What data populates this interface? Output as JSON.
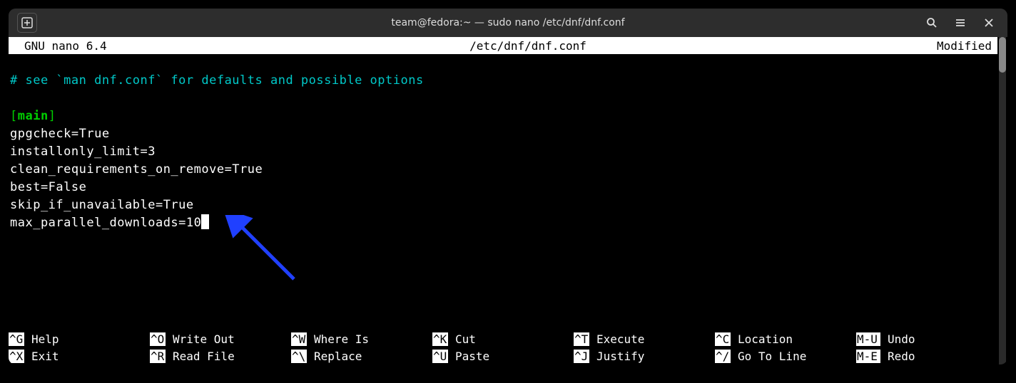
{
  "titlebar": {
    "title": "team@fedora:~ — sudo nano /etc/dnf/dnf.conf"
  },
  "nano": {
    "app_version": "GNU nano 6.4",
    "filename": "/etc/dnf/dnf.conf",
    "status": "Modified"
  },
  "file": {
    "comment": "# see `man dnf.conf` for defaults and possible options",
    "section": "main",
    "lines": {
      "l1": "gpgcheck=True",
      "l2": "installonly_limit=3",
      "l3": "clean_requirements_on_remove=True",
      "l4": "best=False",
      "l5": "skip_if_unavailable=True",
      "l6": "max_parallel_downloads=10"
    }
  },
  "shortcuts": {
    "row1": [
      {
        "key": "^G",
        "label": "Help"
      },
      {
        "key": "^O",
        "label": "Write Out"
      },
      {
        "key": "^W",
        "label": "Where Is"
      },
      {
        "key": "^K",
        "label": "Cut"
      },
      {
        "key": "^T",
        "label": "Execute"
      },
      {
        "key": "^C",
        "label": "Location"
      },
      {
        "key": "M-U",
        "label": "Undo"
      }
    ],
    "row2": [
      {
        "key": "^X",
        "label": "Exit"
      },
      {
        "key": "^R",
        "label": "Read File"
      },
      {
        "key": "^\\",
        "label": "Replace"
      },
      {
        "key": "^U",
        "label": "Paste"
      },
      {
        "key": "^J",
        "label": "Justify"
      },
      {
        "key": "^/",
        "label": "Go To Line"
      },
      {
        "key": "M-E",
        "label": "Redo"
      }
    ]
  }
}
